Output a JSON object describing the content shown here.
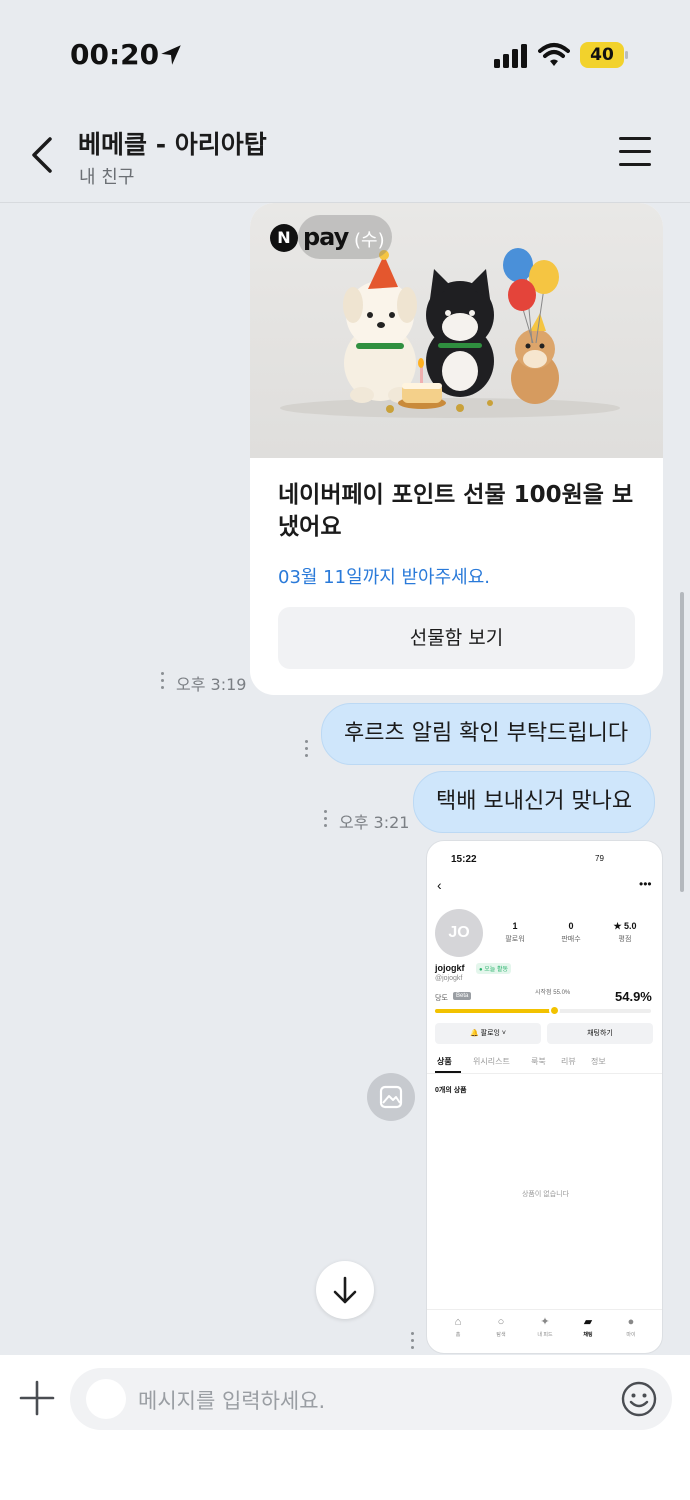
{
  "status_bar": {
    "time": "00:20",
    "battery": "40"
  },
  "header": {
    "title": "베메클 - 아리아탑",
    "subtitle": "내 친구"
  },
  "gift_card": {
    "logo_n": "N",
    "logo_pay": "pay",
    "logo_suffix": "(수)",
    "title": "네이버페이 포인트 선물 100원을 보냈어요",
    "deadline": "03월 11일까지 받아주세요.",
    "button_label": "선물함 보기",
    "time": "오후 3:19"
  },
  "messages": [
    {
      "text": "후르츠 알림 확인 부탁드립니다",
      "time": ""
    },
    {
      "text": "택배 보내신거 맞나요",
      "time": "오후 3:21"
    }
  ],
  "screenshot": {
    "time": "15:22",
    "battery": "79",
    "avatar_initials": "JO",
    "stats": [
      {
        "value": "1",
        "label": "팔로워"
      },
      {
        "value": "0",
        "label": "판매수"
      },
      {
        "value": "★ 5.0",
        "label": "평점"
      }
    ],
    "username": "jojogkf",
    "online_badge": "● 오늘 활동",
    "handle": "@jojogkf",
    "temp_label": "당도",
    "beta_badge": "Beta",
    "start_temp": "시작점 55.0%",
    "temp_value": "54.9%",
    "temp_level": 0.549,
    "follow_button": "팔로잉",
    "chat_button": "채팅하기",
    "tabs": [
      "상품",
      "위시리스트",
      "룩북",
      "리뷰",
      "정보"
    ],
    "product_count": "0개의 상품",
    "empty_text": "상품이 없습니다",
    "nav": [
      "홈",
      "탐색",
      "내 피드",
      "채팅",
      "마이"
    ]
  },
  "input": {
    "placeholder": "메시지를 입력하세요."
  },
  "colors": {
    "bubble": "#cfe6fb",
    "background": "#e8ebef",
    "link_blue": "#2a7ad9",
    "battery": "#f2d22c"
  }
}
